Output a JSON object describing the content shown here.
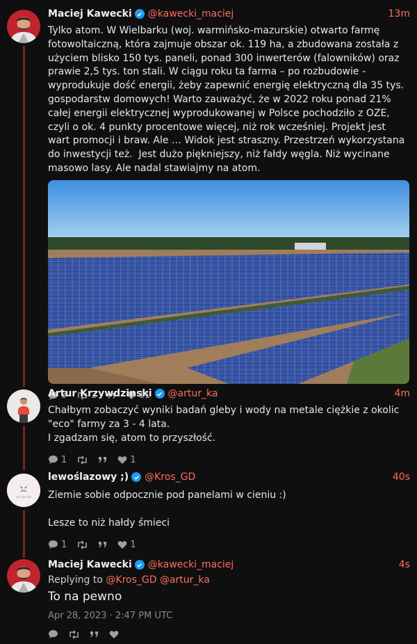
{
  "tweets": [
    {
      "fullname": "Maciej Kawecki",
      "handle": "@kawecki_maciej",
      "time": "13m",
      "text": "Tylko atom. W Wielbarku (woj. warmińsko-mazurskie) otwarto farmę fotowoltaiczną, która zajmuje obszar ok. 119 ha, a zbudowana została z użyciem blisko 150 tys. paneli, ponad 300 inwerterów (falowników) oraz prawie 2,5 tys. ton stali. W ciągu roku ta farma – po rozbudowie - wyprodukuje dość energii, żeby zapewnić energię elektryczną dla 35 tys. gospodarstw domowych! Warto zauważyć, że w 2022 roku ponad 21% całej energii elektrycznej wyprodukowanej w Polsce pochodziło z OZE, czyli o ok. 4 punkty procentowe więcej, niż rok wcześniej. Projekt jest wart promocji i braw. Ale … Widok jest straszny. Przestrzeń wykorzystana do inwestycji też.  Jest dużo piękniejszy, niż fałdy węgla. Niż wycinane masowo lasy. Ale nadal stawiajmy na atom.",
      "replies": "3",
      "retweets": "2",
      "quotes": "",
      "likes": "11"
    },
    {
      "fullname": "Artur Krzywdzinski",
      "handle": "@artur_ka",
      "time": "4m",
      "text": "Chałbym zobaczyć wyniki badań gleby i wody na metale ciężkie z okolic \"eco\" farmy za 3 - 4 lata.\nI zgadzam się, atom to przyszłość.",
      "replies": "1",
      "retweets": "",
      "quotes": "",
      "likes": "1"
    },
    {
      "fullname": "lewoślazowy ;)",
      "handle": "@Kros_GD",
      "time": "40s",
      "text": "Ziemie sobie odpocznie pod panelami w cieniu :)\n\nLesze to niż hałdy śmieci",
      "avatar_text": "you decide",
      "replies": "1",
      "retweets": "",
      "quotes": "",
      "likes": "1"
    },
    {
      "fullname": "Maciej Kawecki",
      "handle": "@kawecki_maciej",
      "time": "4s",
      "replying_label": "Replying to",
      "replying_to": [
        "@Kros_GD",
        "@artur_ka"
      ],
      "text": "To na pewno",
      "date": "Apr 28, 2023 · 2:47 PM UTC"
    }
  ],
  "colors": {
    "background": "#0f0f0f",
    "accent": "#ff6c60",
    "verified": "#1d9bf0",
    "thread_line": "#6b2a2a"
  },
  "icons": [
    "verified-icon",
    "reply-icon",
    "retweet-icon",
    "quote-icon",
    "heart-icon"
  ]
}
